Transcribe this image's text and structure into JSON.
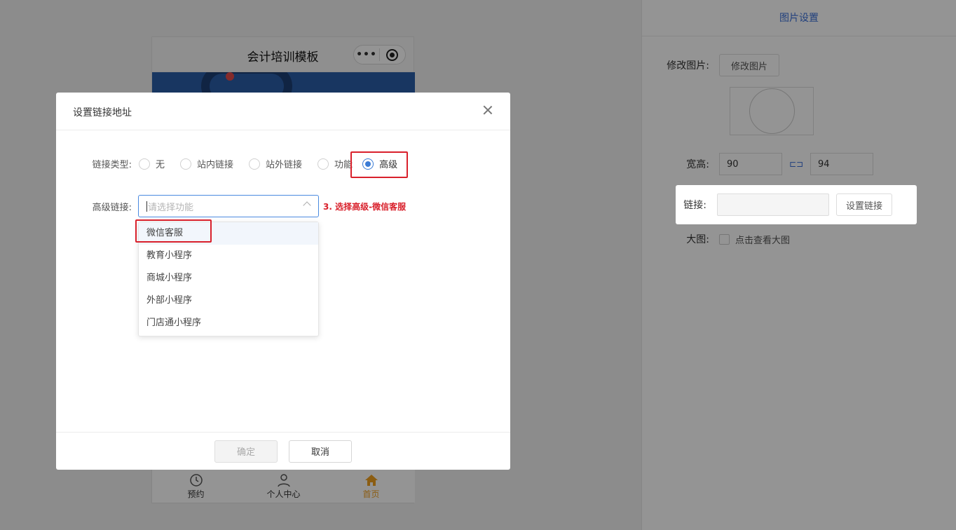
{
  "phone": {
    "title": "会计培训模板",
    "capsule_more": "•••",
    "tabs": [
      {
        "label": "预约",
        "icon": "clock-icon"
      },
      {
        "label": "个人中心",
        "icon": "user-icon"
      },
      {
        "label": "首页",
        "icon": "home-icon"
      }
    ]
  },
  "right_panel": {
    "header": "图片设置",
    "change_image_label": "修改图片:",
    "change_image_button": "修改图片",
    "size_label": "宽高:",
    "width_value": "90",
    "height_value": "94",
    "link_label": "链接:",
    "link_value": "",
    "set_link_button": "设置链接",
    "big_image_label": "大图:",
    "big_image_checkbox_label": "点击查看大图"
  },
  "dialog": {
    "title": "设置链接地址",
    "link_type_label": "链接类型:",
    "link_types": [
      "无",
      "站内链接",
      "站外链接",
      "功能",
      "高级"
    ],
    "selected_link_type": "高级",
    "advanced_link_label": "高级链接:",
    "select_placeholder": "请选择功能",
    "annotation": "3. 选择高级-微信客服",
    "options": [
      "微信客服",
      "教育小程序",
      "商城小程序",
      "外部小程序",
      "门店通小程序"
    ],
    "confirm_button": "确定",
    "cancel_button": "取消"
  },
  "colors": {
    "accent": "#3a7bd5",
    "highlight_red": "#d9212c",
    "tab_active": "#f0a020"
  }
}
